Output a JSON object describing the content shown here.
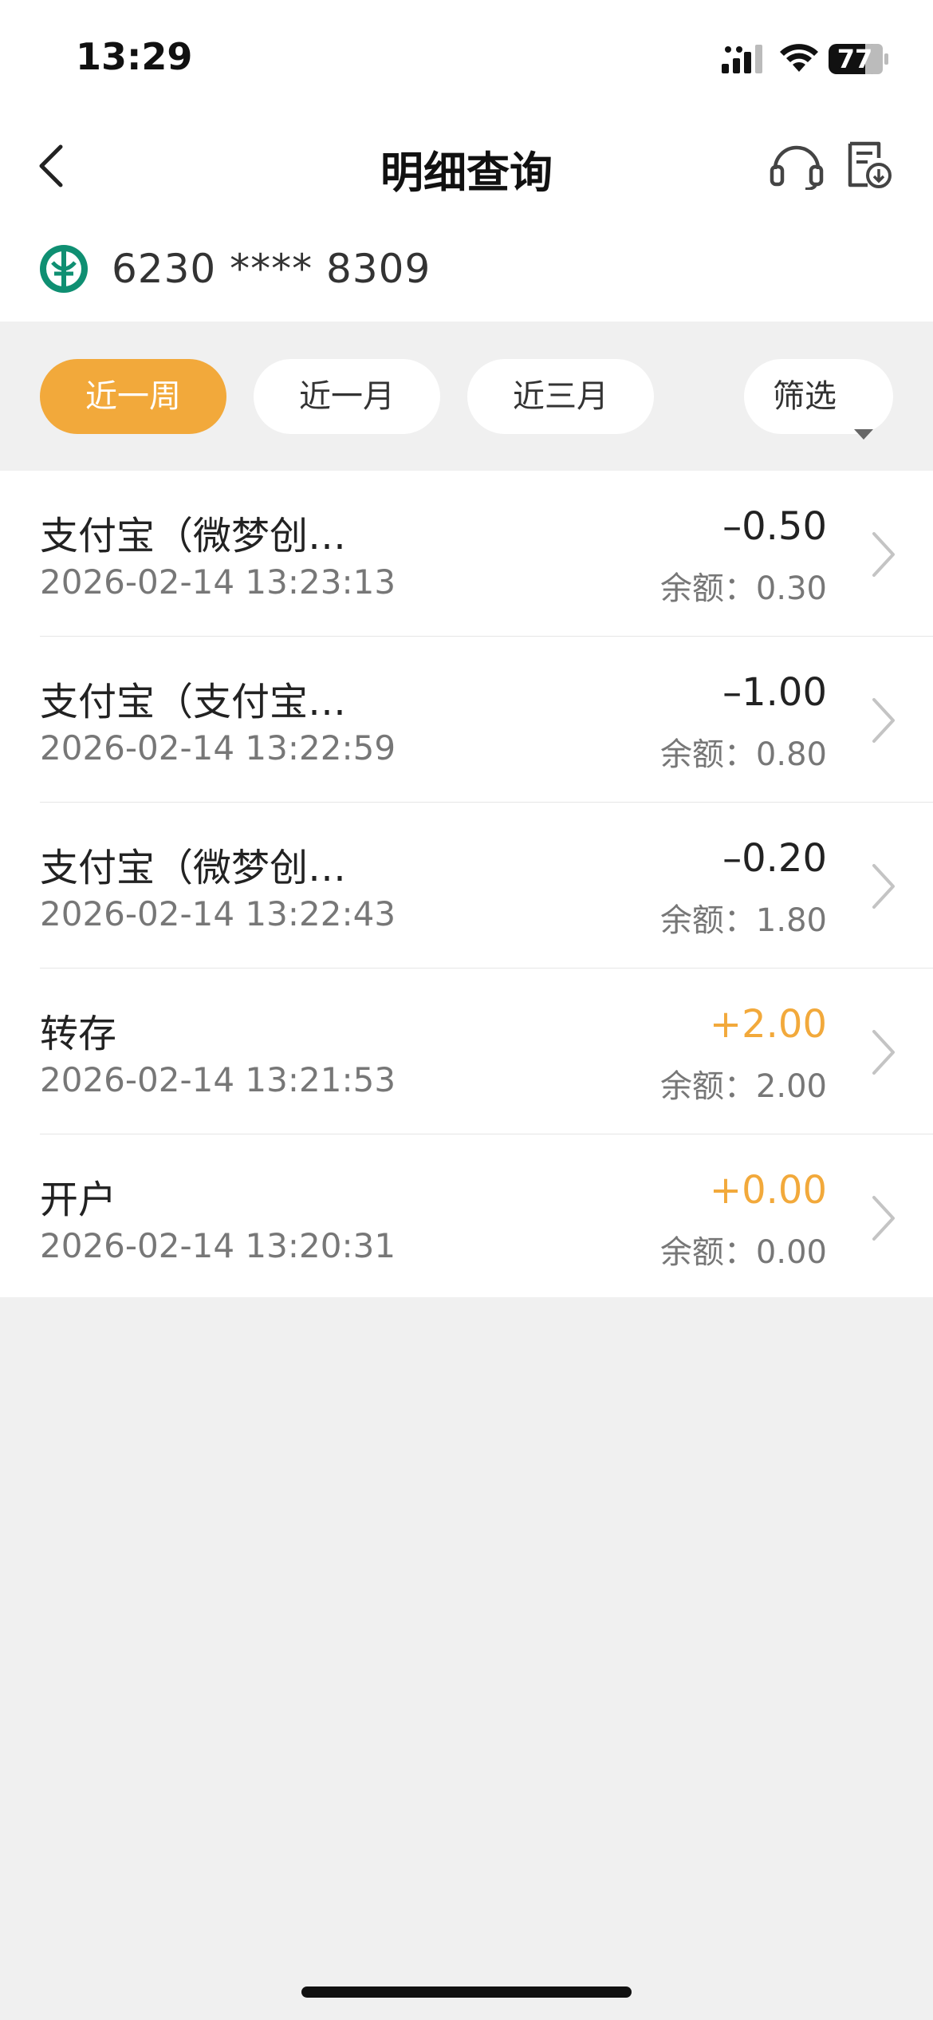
{
  "status_bar": {
    "time": "13:29",
    "battery": "77",
    "icons": [
      "signal-icon",
      "wifi-icon",
      "battery-icon"
    ]
  },
  "nav": {
    "title": "明细查询",
    "icons": [
      "back-icon",
      "headset-icon",
      "export-icon"
    ]
  },
  "account": {
    "number": "6230 **** 8309",
    "logo": "bank-logo",
    "brand_color": "#0f8f72"
  },
  "filters": {
    "week": "近一周",
    "month": "近一月",
    "three_months": "近三月",
    "filter": "筛选",
    "active": "week",
    "accent_color": "#f2a93b"
  },
  "transactions": [
    {
      "name": "支付宝（微梦创…",
      "time": "2026-02-14 13:23:13",
      "amount": "–0.50",
      "balance": "余额：0.30",
      "type": "expense"
    },
    {
      "name": "支付宝（支付宝…",
      "time": "2026-02-14 13:22:59",
      "amount": "–1.00",
      "balance": "余额：0.80",
      "type": "expense"
    },
    {
      "name": "支付宝（微梦创…",
      "time": "2026-02-14 13:22:43",
      "amount": "–0.20",
      "balance": "余额：1.80",
      "type": "expense"
    },
    {
      "name": "转存",
      "time": "2026-02-14 13:21:53",
      "amount": "+2.00",
      "balance": "余额：2.00",
      "type": "income"
    },
    {
      "name": "开户",
      "time": "2026-02-14 13:20:31",
      "amount": "+0.00",
      "balance": "余额：0.00",
      "type": "income"
    }
  ]
}
